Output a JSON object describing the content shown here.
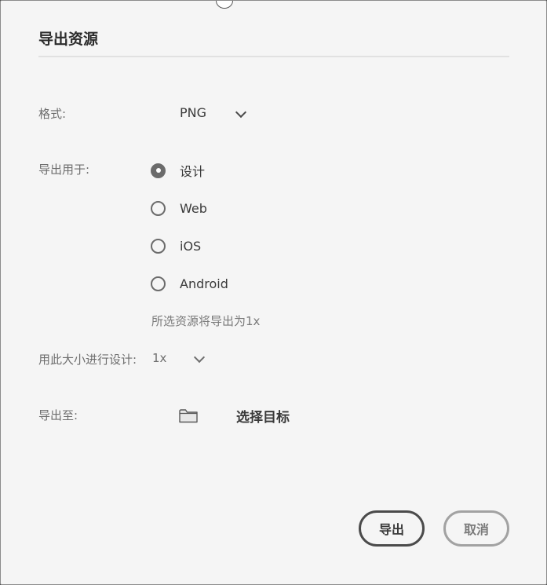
{
  "dialog": {
    "title": "导出资源"
  },
  "format": {
    "label": "格式:",
    "value": "PNG"
  },
  "export_for": {
    "label": "导出用于:",
    "options": [
      {
        "label": "设计",
        "checked": true
      },
      {
        "label": "Web",
        "checked": false
      },
      {
        "label": "iOS",
        "checked": false
      },
      {
        "label": "Android",
        "checked": false
      }
    ],
    "hint": "所选资源将导出为1x"
  },
  "design_size": {
    "label": "用此大小进行设计:",
    "value": "1x"
  },
  "export_to": {
    "label": "导出至:",
    "icon": "folder-icon",
    "target_label": "选择目标"
  },
  "buttons": {
    "export_label": "导出",
    "cancel_label": "取消"
  },
  "colors": {
    "background": "#f5f5f5",
    "primary_border": "#4b4b4b",
    "secondary_border": "#a2a2a2"
  }
}
